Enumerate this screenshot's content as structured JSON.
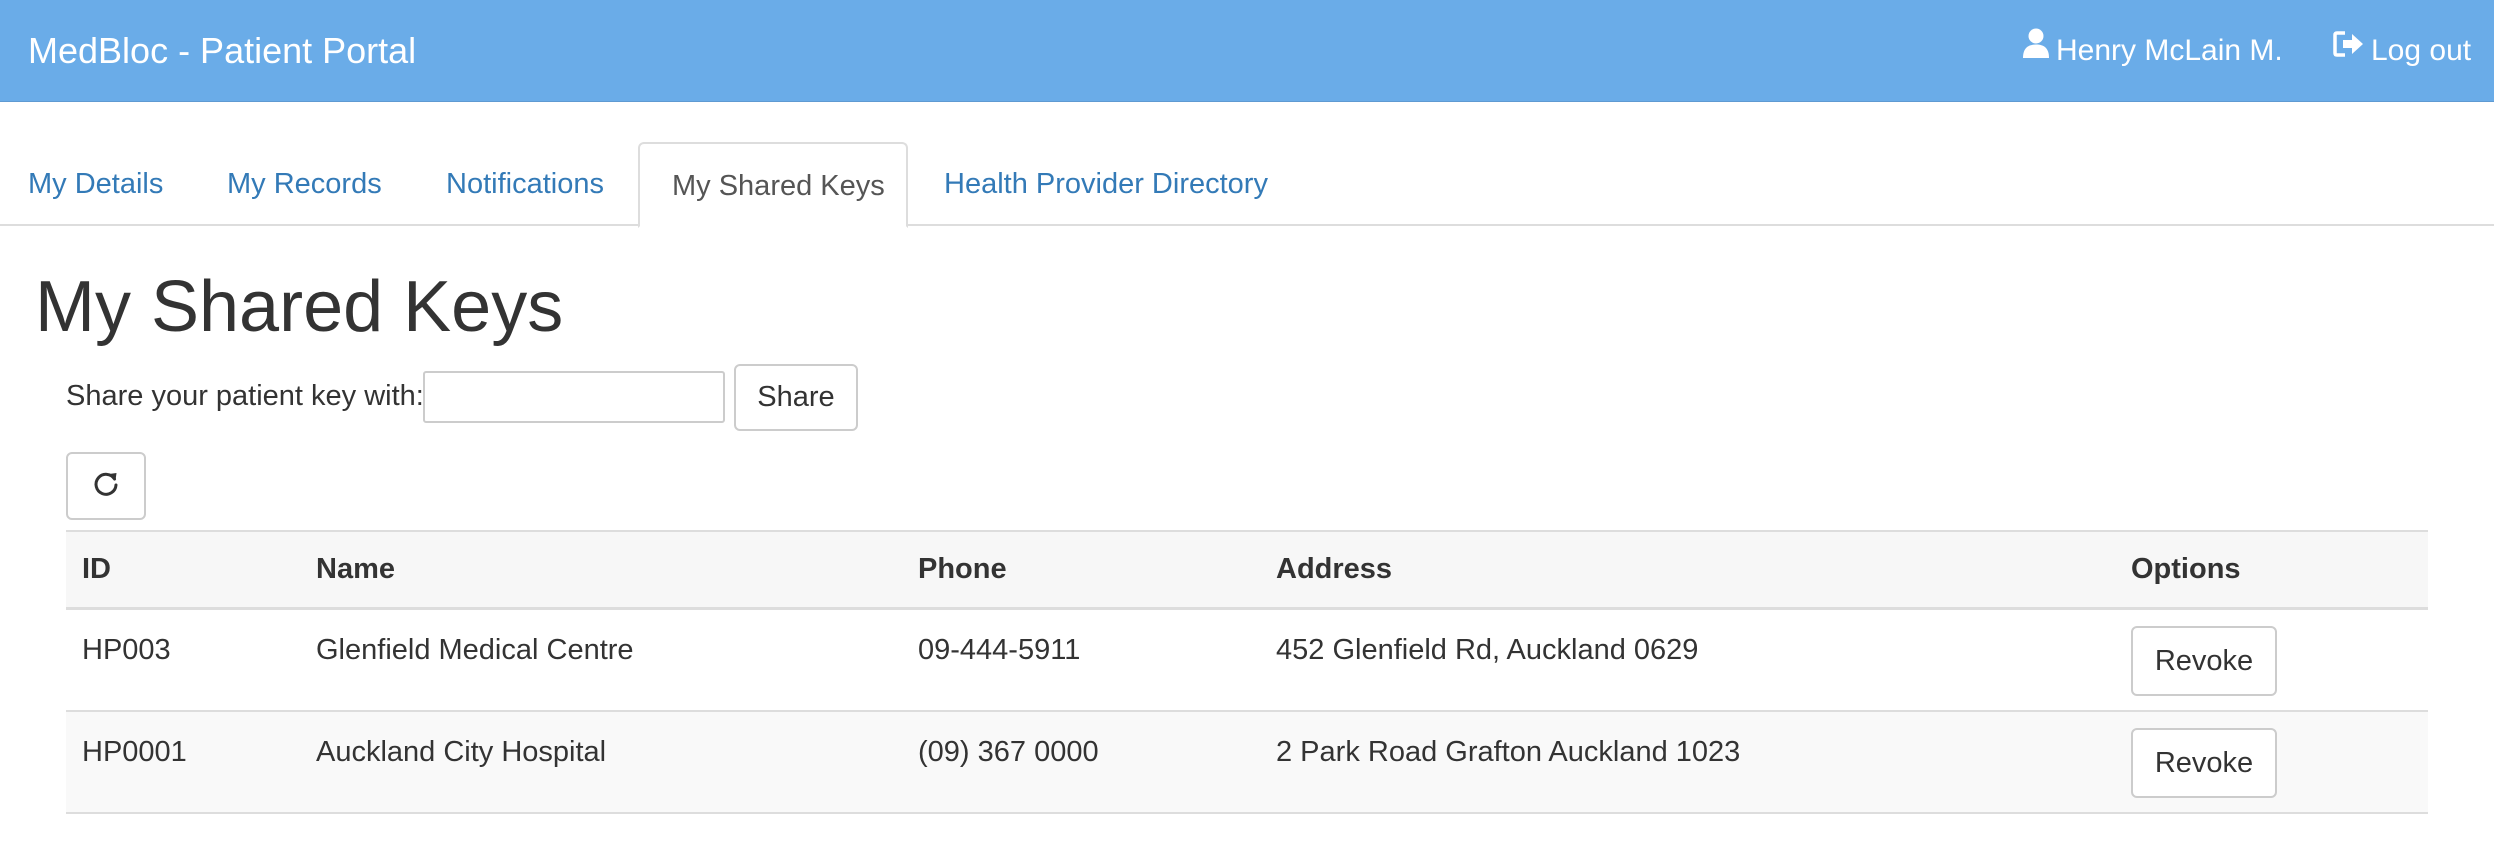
{
  "navbar": {
    "brand": "MedBloc - Patient Portal",
    "user_label": "Henry McLain M.",
    "logout_label": "Log out",
    "background_color": "#6aace8"
  },
  "tabs": [
    {
      "label": "My Details",
      "active": false
    },
    {
      "label": "My Records",
      "active": false
    },
    {
      "label": "Notifications",
      "active": false
    },
    {
      "label": "My Shared Keys",
      "active": true
    },
    {
      "label": "Health Provider Directory",
      "active": false
    }
  ],
  "main": {
    "title": "My Shared Keys",
    "share": {
      "label": "Share your patient key with:",
      "input_value": "",
      "input_placeholder": "",
      "button_label": "Share"
    },
    "refresh_icon": "refresh-icon",
    "table": {
      "headers": [
        "ID",
        "Name",
        "Phone",
        "Address",
        "Options"
      ],
      "rows": [
        {
          "id": "HP003",
          "name": "Glenfield Medical Centre",
          "phone": "09-444-5911",
          "address": "452 Glenfield Rd, Auckland 0629",
          "action": "Revoke"
        },
        {
          "id": "HP0001",
          "name": "Auckland City Hospital",
          "phone": "(09) 367 0000",
          "address": "2 Park Road Grafton Auckland 1023",
          "action": "Revoke"
        }
      ]
    }
  },
  "colors": {
    "link": "#337ab7",
    "text": "#333333",
    "border": "#dddddd"
  }
}
